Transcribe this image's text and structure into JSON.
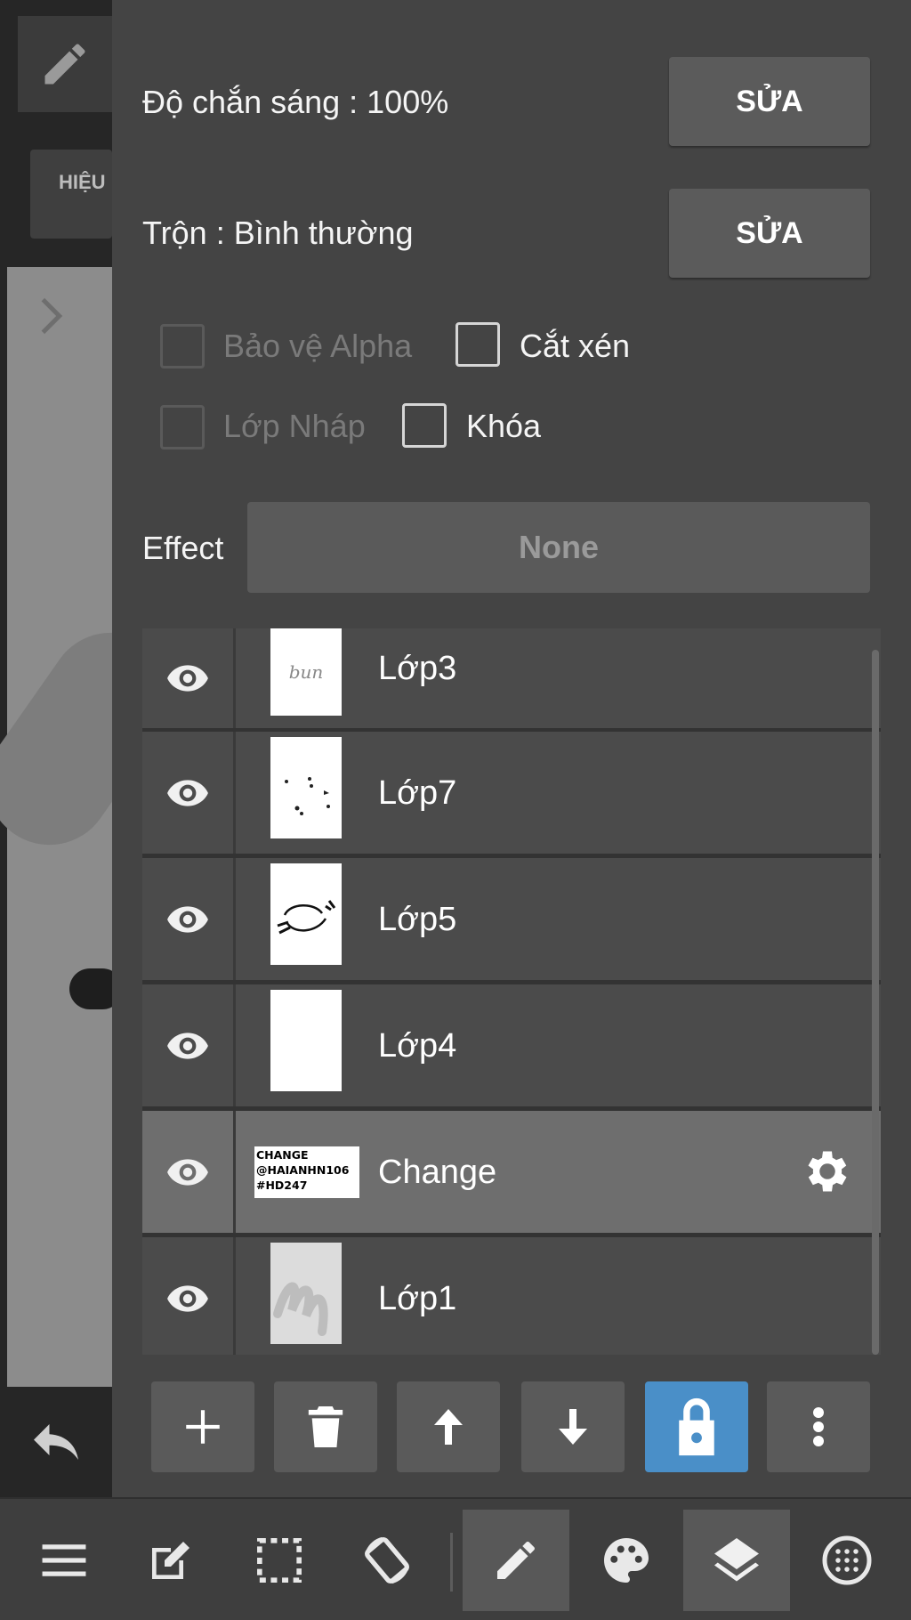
{
  "colors": {
    "panel_bg": "#444444",
    "row_bg": "#4b4b4b",
    "row_selected_bg": "#6e6e6e",
    "accent_blue": "#4a8fc8",
    "button_bg": "#5a5a5a"
  },
  "left_strip": {
    "effect_tab_label": "HIỆU"
  },
  "panel": {
    "opacity": {
      "label": "Độ chắn sáng : 100%",
      "button": "SỬA"
    },
    "blend": {
      "label": "Trộn : Bình thường",
      "button": "SỬA"
    },
    "checkboxes": {
      "alpha_protect": {
        "label": "Bảo vệ Alpha",
        "checked": false,
        "enabled": false
      },
      "clipping": {
        "label": "Cắt xén",
        "checked": false,
        "enabled": true
      },
      "draft_layer": {
        "label": "Lớp Nháp",
        "checked": false,
        "enabled": false
      },
      "lock": {
        "label": "Khóa",
        "checked": false,
        "enabled": true
      }
    },
    "effect": {
      "label": "Effect",
      "value": "None"
    }
  },
  "layers": [
    {
      "name": "Lớp3",
      "visible": true,
      "selected": false,
      "thumb_text": "bun"
    },
    {
      "name": "Lớp7",
      "visible": true,
      "selected": false
    },
    {
      "name": "Lớp5",
      "visible": true,
      "selected": false
    },
    {
      "name": "Lớp4",
      "visible": true,
      "selected": false
    },
    {
      "name": "Change",
      "visible": true,
      "selected": true,
      "thumb_lines": [
        "CHANGE",
        "@HAIANHN106",
        "#HD247"
      ]
    },
    {
      "name": "Lớp1",
      "visible": true,
      "selected": false
    }
  ],
  "layer_actions": [
    "add-icon",
    "trash-icon",
    "arrow-up-icon",
    "arrow-down-icon",
    "lock-icon",
    "more-vert-icon"
  ],
  "bottom_toolbar": [
    "menu-icon",
    "edit-icon",
    "selection-icon",
    "rotate-icon",
    "pen-icon",
    "palette-icon",
    "layers-icon",
    "grid-icon"
  ]
}
